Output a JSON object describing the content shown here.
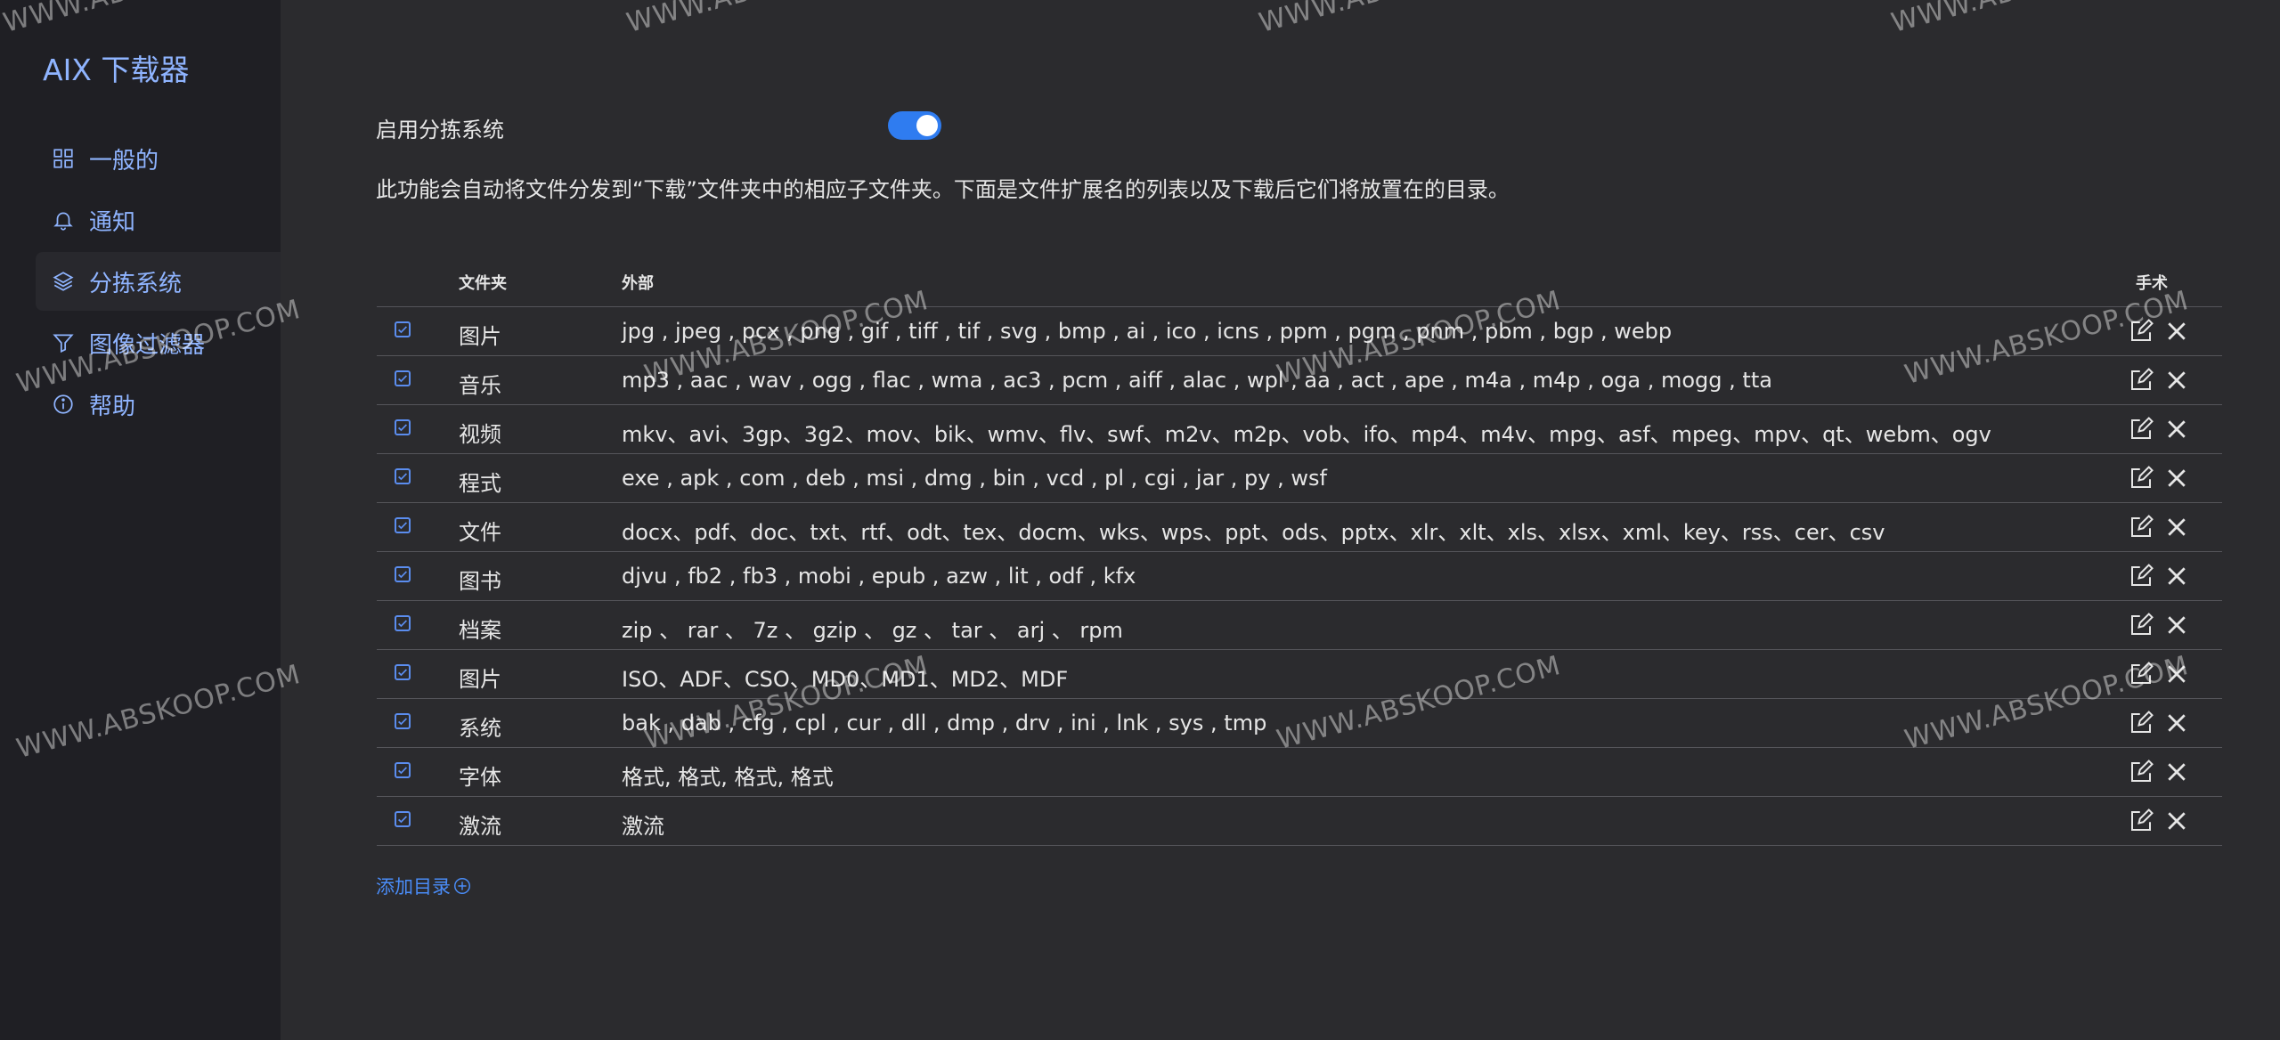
{
  "app": {
    "title": "AIX 下载器"
  },
  "sidebar": {
    "items": [
      {
        "label": "一般的",
        "icon": "grid-icon"
      },
      {
        "label": "通知",
        "icon": "bell-icon"
      },
      {
        "label": "分拣系统",
        "icon": "layers-icon",
        "active": true
      },
      {
        "label": "图像过滤器",
        "icon": "filter-icon"
      },
      {
        "label": "帮助",
        "icon": "info-icon"
      }
    ]
  },
  "main": {
    "toggle_label": "启用分拣系统",
    "toggle_on": true,
    "description": "此功能会自动将文件分发到“下载”文件夹中的相应子文件夹。下面是文件扩展名的列表以及下载后它们将放置在的目录。",
    "table": {
      "headers": {
        "folder": "文件夹",
        "ext": "外部",
        "actions": "手术"
      },
      "rows": [
        {
          "checked": true,
          "folder": "图片",
          "ext": "jpg , jpeg , pcx , png , gif , tiff , tif , svg , bmp , ai , ico , icns , ppm , pgm , pnm , pbm , bgp , webp"
        },
        {
          "checked": true,
          "folder": "音乐",
          "ext": "mp3 , aac , wav , ogg , flac , wma , ac3 , pcm , aiff , alac , wpl , aa , act , ape , m4a , m4p , oga , mogg , tta"
        },
        {
          "checked": true,
          "folder": "视频",
          "ext": "mkv、avi、3gp、3g2、mov、bik、wmv、flv、swf、m2v、m2p、vob、ifo、mp4、m4v、mpg、asf、mpeg、mpv、qt、webm、ogv"
        },
        {
          "checked": true,
          "folder": "程式",
          "ext": "exe , apk , com , deb , msi , dmg , bin , vcd , pl , cgi , jar , py , wsf"
        },
        {
          "checked": true,
          "folder": "文件",
          "ext": "docx、pdf、doc、txt、rtf、odt、tex、docm、wks、wps、ppt、ods、pptx、xlr、xlt、xls、xlsx、xml、key、rss、cer、csv"
        },
        {
          "checked": true,
          "folder": "图书",
          "ext": "djvu , fb2 , fb3 , mobi , epub , azw , lit , odf , kfx"
        },
        {
          "checked": true,
          "folder": "档案",
          "ext": "zip 、 rar 、 7z 、 gzip 、 gz 、 tar 、 arj 、 rpm"
        },
        {
          "checked": true,
          "folder": "图片",
          "ext": "ISO、ADF、CSO、MD0、MD1、MD2、MDF"
        },
        {
          "checked": true,
          "folder": "系统",
          "ext": "bak , dab , cfg , cpl , cur , dll , dmp , drv , ini , lnk , sys , tmp"
        },
        {
          "checked": true,
          "folder": "字体",
          "ext": "格式, 格式, 格式, 格式"
        },
        {
          "checked": true,
          "folder": "激流",
          "ext": "激流"
        }
      ]
    },
    "add_directory": "添加目录"
  },
  "watermark": "WWW.ABSKOOP.COM",
  "colors": {
    "accent": "#2f7cf0",
    "link": "#8fb4ff",
    "sidebar_bg": "#1f1f24",
    "main_bg": "#2b2b2e"
  }
}
